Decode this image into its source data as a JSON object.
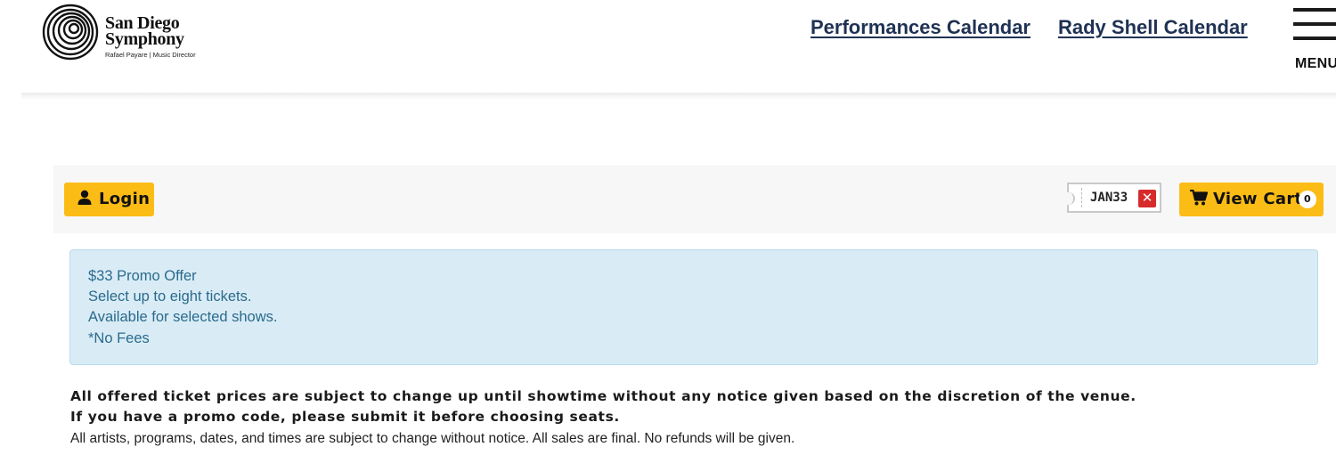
{
  "header": {
    "logo": {
      "line1": "San Diego",
      "line2": "Symphony",
      "subtitle": "Rafael Payare | Music Director"
    },
    "nav": {
      "performances_calendar": "Performances Calendar",
      "rady_shell_calendar": "Rady Shell Calendar"
    },
    "menu_label": "MENU",
    "icons": {
      "logo": "concentric-circles-logo",
      "menu": "hamburger-icon"
    }
  },
  "toolbar": {
    "login_label": "Login",
    "login_icon": "user-icon",
    "promo_code": "JAN33",
    "promo_remove_icon": "close-icon",
    "view_cart_label": "View Cart",
    "cart_icon": "cart-icon",
    "cart_count": "0"
  },
  "promo_box": {
    "lines": [
      "$33 Promo Offer",
      "Select up to eight tickets.",
      "Available for selected shows.",
      "*No Fees"
    ]
  },
  "notices": {
    "bold_lines": [
      "All offered ticket prices are subject to change up until showtime without any notice given based on the discretion of the venue.",
      "If you have a promo code, please submit it before choosing seats."
    ],
    "plain": "All artists, programs, dates, and times are subject to change without notice. All sales are final. No refunds will be given."
  },
  "colors": {
    "accent_yellow": "#fcbc16",
    "nav_link": "#1f3253",
    "info_bg": "#d9ecf6",
    "info_text": "#2b6a8c",
    "remove_red": "#d72b2b"
  }
}
